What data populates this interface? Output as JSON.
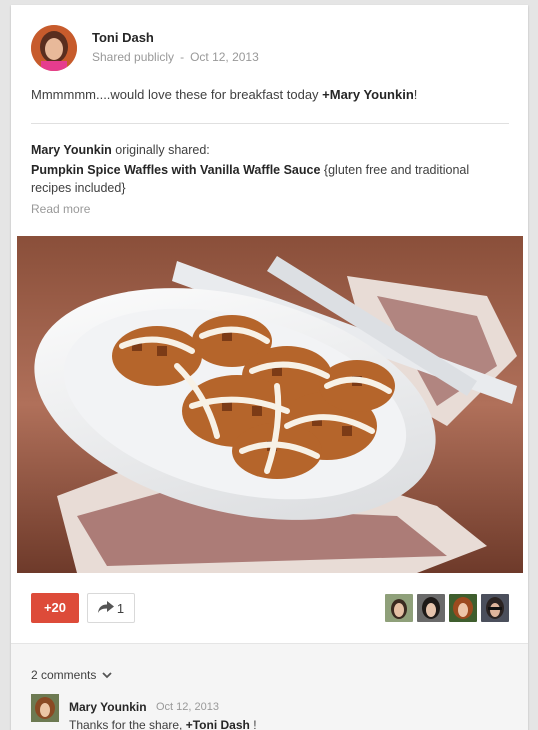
{
  "post": {
    "author": "Toni Dash",
    "visibility": "Shared publicly",
    "date": "Oct 12, 2013",
    "text_before": "Mmmmmm....would love these for breakfast today ",
    "mention": "+Mary Younkin",
    "text_after": "!"
  },
  "original": {
    "author": "Mary Younkin",
    "shared_label": " originally shared:",
    "title": "Pumpkin Spice Waffles with Vanilla Waffle Sauce",
    "title_suffix": " {gluten free and traditional recipes included}",
    "read_more": "Read more"
  },
  "actions": {
    "plus_one": "+20",
    "shares": "1"
  },
  "comments": {
    "count_label": "2 comments",
    "items": [
      {
        "author": "Mary Younkin",
        "date": "Oct 12, 2013",
        "text_before": "Thanks for the share, ",
        "mention": "+Toni Dash",
        "text_after": " !"
      }
    ]
  },
  "colors": {
    "plus_red": "#dd4b39",
    "accent": "#262626"
  },
  "icons": [
    "share-arrow-icon",
    "chevron-down-icon"
  ]
}
